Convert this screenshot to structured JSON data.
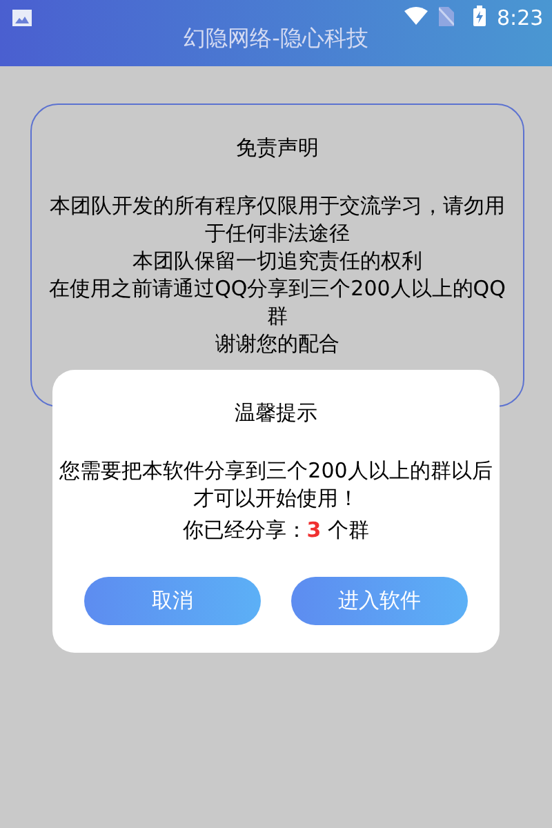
{
  "status_bar": {
    "time": "8:23"
  },
  "app_bar": {
    "title": "幻隐网络-隐心科技"
  },
  "disclaimer": {
    "title": "免责声明",
    "lines": [
      "本团队开发的所有程序仅限用于交流学习，请勿用于任何非法途径",
      "本团队保留一切追究责任的权利",
      "在使用之前请通过QQ分享到三个200人以上的QQ群",
      "谢谢您的配合"
    ]
  },
  "dialog": {
    "title": "温馨提示",
    "message": "您需要把本软件分享到三个200人以上的群以后才可以开始使用！",
    "shared_prefix": "你已经分享：",
    "shared_count": "3",
    "shared_suffix": "个群",
    "buttons": [
      {
        "label": "取消"
      },
      {
        "label": "进入软件"
      }
    ]
  }
}
